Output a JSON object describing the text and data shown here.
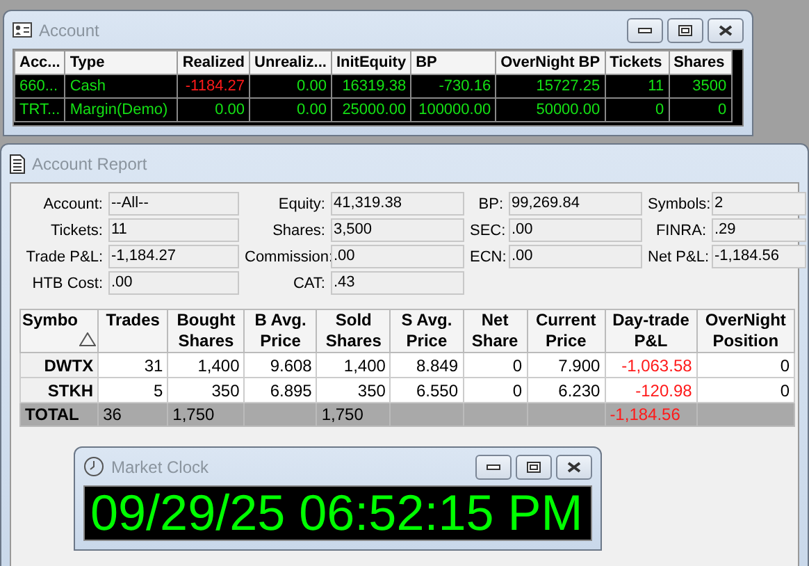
{
  "account_window": {
    "title": "Account",
    "columns": [
      "Acc...",
      "Type",
      "Realized",
      "Unrealiz...",
      "InitEquity",
      "BP",
      "OverNight BP",
      "Tickets",
      "Shares"
    ],
    "rows": [
      {
        "cells": [
          "660...",
          "Cash",
          "-1184.27",
          "0.00",
          "16319.38",
          "-730.16",
          "15727.25",
          "11",
          "3500"
        ],
        "negative": [
          false,
          false,
          true,
          false,
          false,
          false,
          false,
          false,
          false
        ]
      },
      {
        "cells": [
          "TRT...",
          "Margin(Demo)",
          "0.00",
          "0.00",
          "25000.00",
          "100000.00",
          "50000.00",
          "0",
          "0"
        ],
        "negative": [
          false,
          false,
          false,
          false,
          false,
          false,
          false,
          false,
          false
        ]
      }
    ]
  },
  "report_window": {
    "title": "Account Report",
    "fields": [
      [
        {
          "label": "Account:",
          "value": "--All--"
        },
        {
          "label": "Equity:",
          "value": "41,319.38"
        },
        {
          "label": "BP:",
          "value": "99,269.84"
        },
        {
          "label": "Symbols:",
          "value": "2"
        }
      ],
      [
        {
          "label": "Tickets:",
          "value": "11"
        },
        {
          "label": "Shares:",
          "value": "3,500"
        },
        {
          "label": "SEC:",
          "value": ".00"
        },
        {
          "label": "FINRA:",
          "value": ".29"
        }
      ],
      [
        {
          "label": "Trade P&L:",
          "value": "-1,184.27"
        },
        {
          "label": "Commission:",
          "value": ".00"
        },
        {
          "label": "ECN:",
          "value": ".00"
        },
        {
          "label": "Net P&L:",
          "value": "-1,184.56"
        }
      ],
      [
        {
          "label": "HTB Cost:",
          "value": ".00"
        },
        {
          "label": "CAT:",
          "value": ".43"
        }
      ]
    ],
    "table": {
      "columns": [
        "Symbo",
        "Trades",
        "Bought Shares",
        "B Avg. Price",
        "Sold Shares",
        "S Avg. Price",
        "Net Share",
        "Current Price",
        "Day-trade P&L",
        "OverNight Position"
      ],
      "rows": [
        {
          "cells": [
            "DWTX",
            "31",
            "1,400",
            "9.608",
            "1,400",
            "8.849",
            "0",
            "7.900",
            "-1,063.58",
            "0"
          ]
        },
        {
          "cells": [
            "STKH",
            "5",
            "350",
            "6.895",
            "350",
            "6.550",
            "0",
            "6.230",
            "-120.98",
            "0"
          ]
        }
      ],
      "total": {
        "cells": [
          "TOTAL",
          "36",
          "1,750",
          "",
          "1,750",
          "",
          "",
          "",
          "-1,184.56",
          ""
        ]
      }
    }
  },
  "clock_window": {
    "title": "Market Clock",
    "time": "09/29/25 06:52:15 PM"
  }
}
